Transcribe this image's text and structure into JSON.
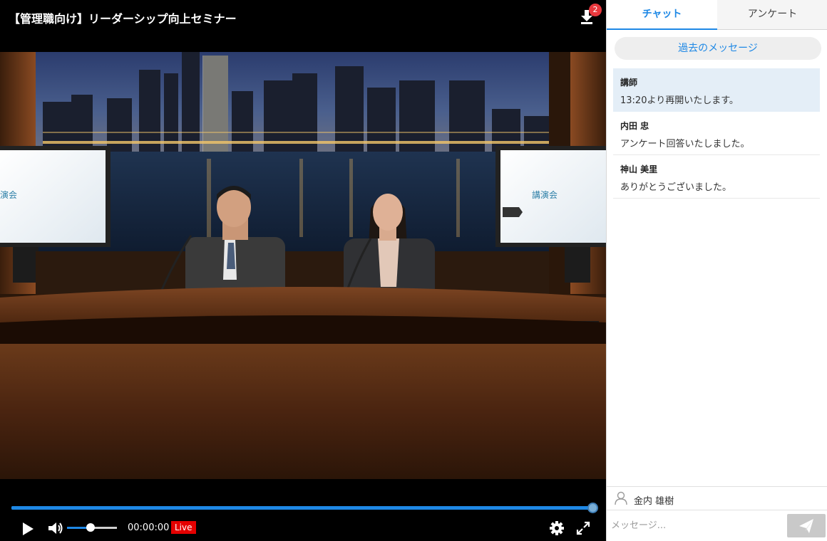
{
  "player": {
    "title": "【管理職向け】リーダーシップ向上セミナー",
    "download_badge": "2",
    "time": "00:00:00",
    "live_label": "Live",
    "progress": 1.0,
    "volume": 0.45,
    "slides": {
      "left_title": "演会",
      "right_title": "講演会"
    }
  },
  "panel": {
    "tabs": [
      {
        "label": "チャット",
        "active": true
      },
      {
        "label": "アンケート",
        "active": false
      }
    ],
    "past_messages_label": "過去のメッセージ",
    "messages": [
      {
        "name": "講師",
        "text": "13:20より再開いたします。",
        "highlight": true
      },
      {
        "name": "内田 忠",
        "text": "アンケート回答いたしました。",
        "highlight": false
      },
      {
        "name": "神山 美里",
        "text": "ありがとうございました。",
        "highlight": false
      }
    ],
    "user_name": "金内 雄樹",
    "input_placeholder": "メッセージ..."
  },
  "colors": {
    "accent": "#1e88e5",
    "live": "#e50000",
    "badge": "#e8383d",
    "highlight_row": "#e4eef7"
  },
  "icons": {
    "download": "download-icon",
    "play": "play-icon",
    "volume": "volume-icon",
    "settings": "gear-icon",
    "fullscreen": "fullscreen-icon",
    "user": "user-icon",
    "send": "send-icon"
  }
}
